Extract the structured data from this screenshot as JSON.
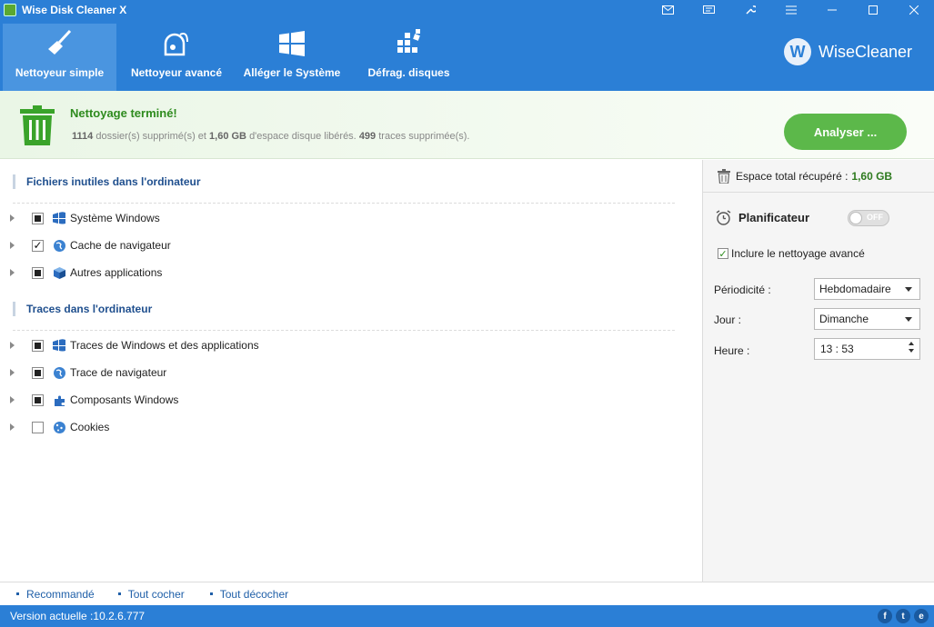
{
  "titlebar": {
    "title": "Wise Disk Cleaner X",
    "controls": [
      "mail-icon",
      "chat-icon",
      "tools-icon",
      "menu-icon",
      "minimize-icon",
      "maximize-icon",
      "close-icon"
    ]
  },
  "nav": {
    "tabs": [
      {
        "label": "Nettoyeur simple",
        "icon": "broom-icon",
        "active": true
      },
      {
        "label": "Nettoyeur avancé",
        "icon": "vacuum-icon",
        "active": false
      },
      {
        "label": "Alléger le Système",
        "icon": "windows-icon",
        "active": false
      },
      {
        "label": "Défrag. disques",
        "icon": "defrag-icon",
        "active": false
      }
    ],
    "brand": {
      "logo_letter": "W",
      "name": "WiseCleaner"
    }
  },
  "banner": {
    "title": "Nettoyage terminé!",
    "folders_count": "1114",
    "folders_text": "dossier(s) supprimé(s) et",
    "space": "1,60 GB",
    "space_text": "d'espace disque libérés.",
    "traces_count": "499",
    "traces_text": "traces supprimée(s).",
    "analyze_button": "Analyser ..."
  },
  "sections": [
    {
      "title": "Fichiers inutiles dans l'ordinateur",
      "items": [
        {
          "label": "Système Windows",
          "state": "partial",
          "icon": "windows-flag-icon"
        },
        {
          "label": "Cache de navigateur",
          "state": "checked",
          "icon": "globe-icon"
        },
        {
          "label": "Autres applications",
          "state": "partial",
          "icon": "cube-icon"
        }
      ]
    },
    {
      "title": "Traces dans l'ordinateur",
      "items": [
        {
          "label": "Traces de Windows et des applications",
          "state": "partial",
          "icon": "windows-flag-icon"
        },
        {
          "label": "Trace de navigateur",
          "state": "partial",
          "icon": "globe-icon"
        },
        {
          "label": "Composants Windows",
          "state": "partial",
          "icon": "puzzle-icon"
        },
        {
          "label": "Cookies",
          "state": "unchecked",
          "icon": "cookie-icon"
        }
      ]
    }
  ],
  "right": {
    "space_label": "Espace total récupéré :",
    "space_value": "1,60 GB",
    "scheduler_title": "Planificateur",
    "toggle_label": "OFF",
    "include_label": "Inclure le nettoyage avancé",
    "fields": {
      "periodicity_label": "Périodicité :",
      "periodicity_value": "Hebdomadaire",
      "day_label": "Jour :",
      "day_value": "Dimanche",
      "hour_label": "Heure :",
      "hour_value": "13 : 53"
    }
  },
  "footer": {
    "links": [
      "Recommandé",
      "Tout cocher",
      "Tout décocher"
    ],
    "version": "Version actuelle :10.2.6.777",
    "social": [
      "f",
      "t",
      "e"
    ]
  },
  "colors": {
    "primary": "#2b7fd6",
    "success": "#2e8b1e",
    "analyze": "#5cb84a",
    "link": "#1f5fa8"
  }
}
